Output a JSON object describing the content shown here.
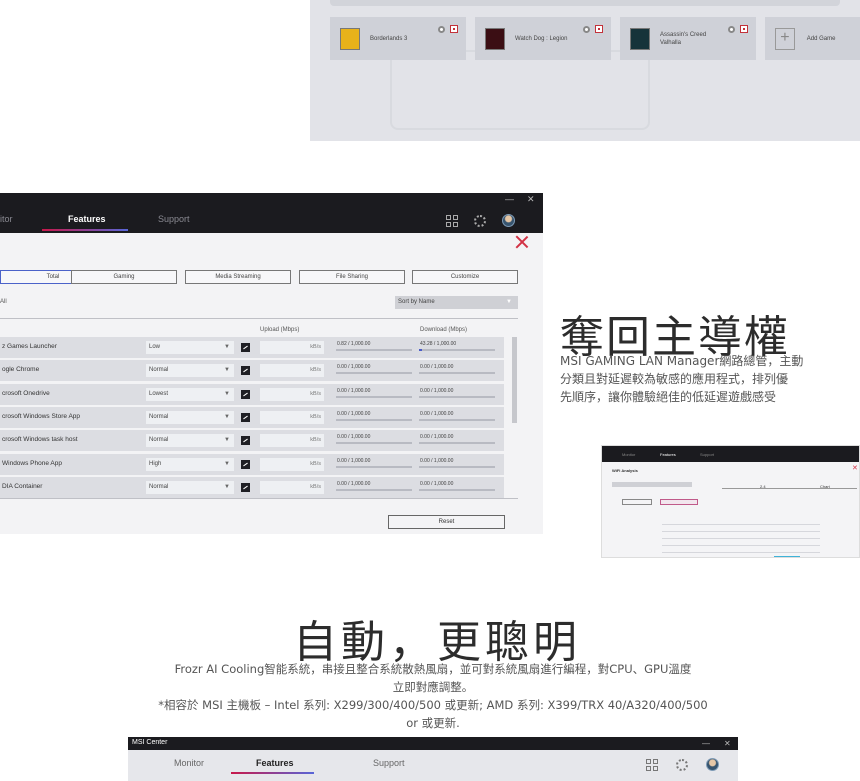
{
  "games_panel": {
    "games": [
      {
        "title": "Borderlands 3"
      },
      {
        "title": "Watch Dog : Legion"
      },
      {
        "title": "Assassin's Creed Valhalla"
      }
    ],
    "add_game_label": "Add Game"
  },
  "lan_manager": {
    "tabs": [
      "itor",
      "Features",
      "Support"
    ],
    "active_tab": "Features",
    "filters": [
      "Total",
      "Gaming",
      "Media Streaming",
      "File Sharing",
      "Customize"
    ],
    "active_filter": "Total",
    "all_label": "All",
    "sort_label": "Sort by Name",
    "upload_header": "Upload (Mbps)",
    "download_header": "Download (Mbps)",
    "unit": "kB/s",
    "rows": [
      {
        "name": "z Games Launcher",
        "priority": "Low",
        "upload": "0.82 / 1,000.00",
        "download": "43.28 / 1,000.00",
        "download_fill": 0.043
      },
      {
        "name": "ogle Chrome",
        "priority": "Normal",
        "upload": "0.00 / 1,000.00",
        "download": "0.00 / 1,000.00",
        "download_fill": 0
      },
      {
        "name": "crosoft Onedrive",
        "priority": "Lowest",
        "upload": "0.00 / 1,000.00",
        "download": "0.00 / 1,000.00",
        "download_fill": 0
      },
      {
        "name": "crosoft Windows Store App",
        "priority": "Normal",
        "upload": "0.00 / 1,000.00",
        "download": "0.00 / 1,000.00",
        "download_fill": 0
      },
      {
        "name": "crosoft Windows task host",
        "priority": "Normal",
        "upload": "0.00 / 1,000.00",
        "download": "0.00 / 1,000.00",
        "download_fill": 0
      },
      {
        "name": "Windows Phone App",
        "priority": "High",
        "upload": "0.00 / 1,000.00",
        "download": "0.00 / 1,000.00",
        "download_fill": 0
      },
      {
        "name": "DIA Container",
        "priority": "Normal",
        "upload": "0.00 / 1,000.00",
        "download": "0.00 / 1,000.00",
        "download_fill": 0
      }
    ],
    "reset_label": "Reset"
  },
  "section_lan": {
    "heading": "奪回主導權",
    "desc_lines": [
      "MSI GAMING LAN Manager網路總管，主動",
      "分類且對延遲較為敏感的應用程式，排列優",
      "先順序，讓你體驗絕佳的低延遲遊戲感受"
    ]
  },
  "wifi_thumb": {
    "tabs": [
      "Monitor",
      "Features",
      "Support"
    ],
    "title": "WiFi Analysis",
    "band_a": "2.4",
    "band_b": "Chart"
  },
  "section_cooling": {
    "heading": "自動，更聰明",
    "desc_lines": [
      "Frozr AI Cooling智能系統，串接且整合系統散熱風扇，並可對系統風扇進行編程，對CPU、GPU溫度",
      "立即對應調整。",
      "*相容於 MSI 主機板 – Intel 系列: X299/300/400/500 或更新; AMD 系列: X399/TRX 40/A320/400/500",
      "or 或更新."
    ]
  },
  "msi_center": {
    "title": "MSI Center",
    "tabs": [
      "Monitor",
      "Features",
      "Support"
    ],
    "active_tab": "Features"
  }
}
